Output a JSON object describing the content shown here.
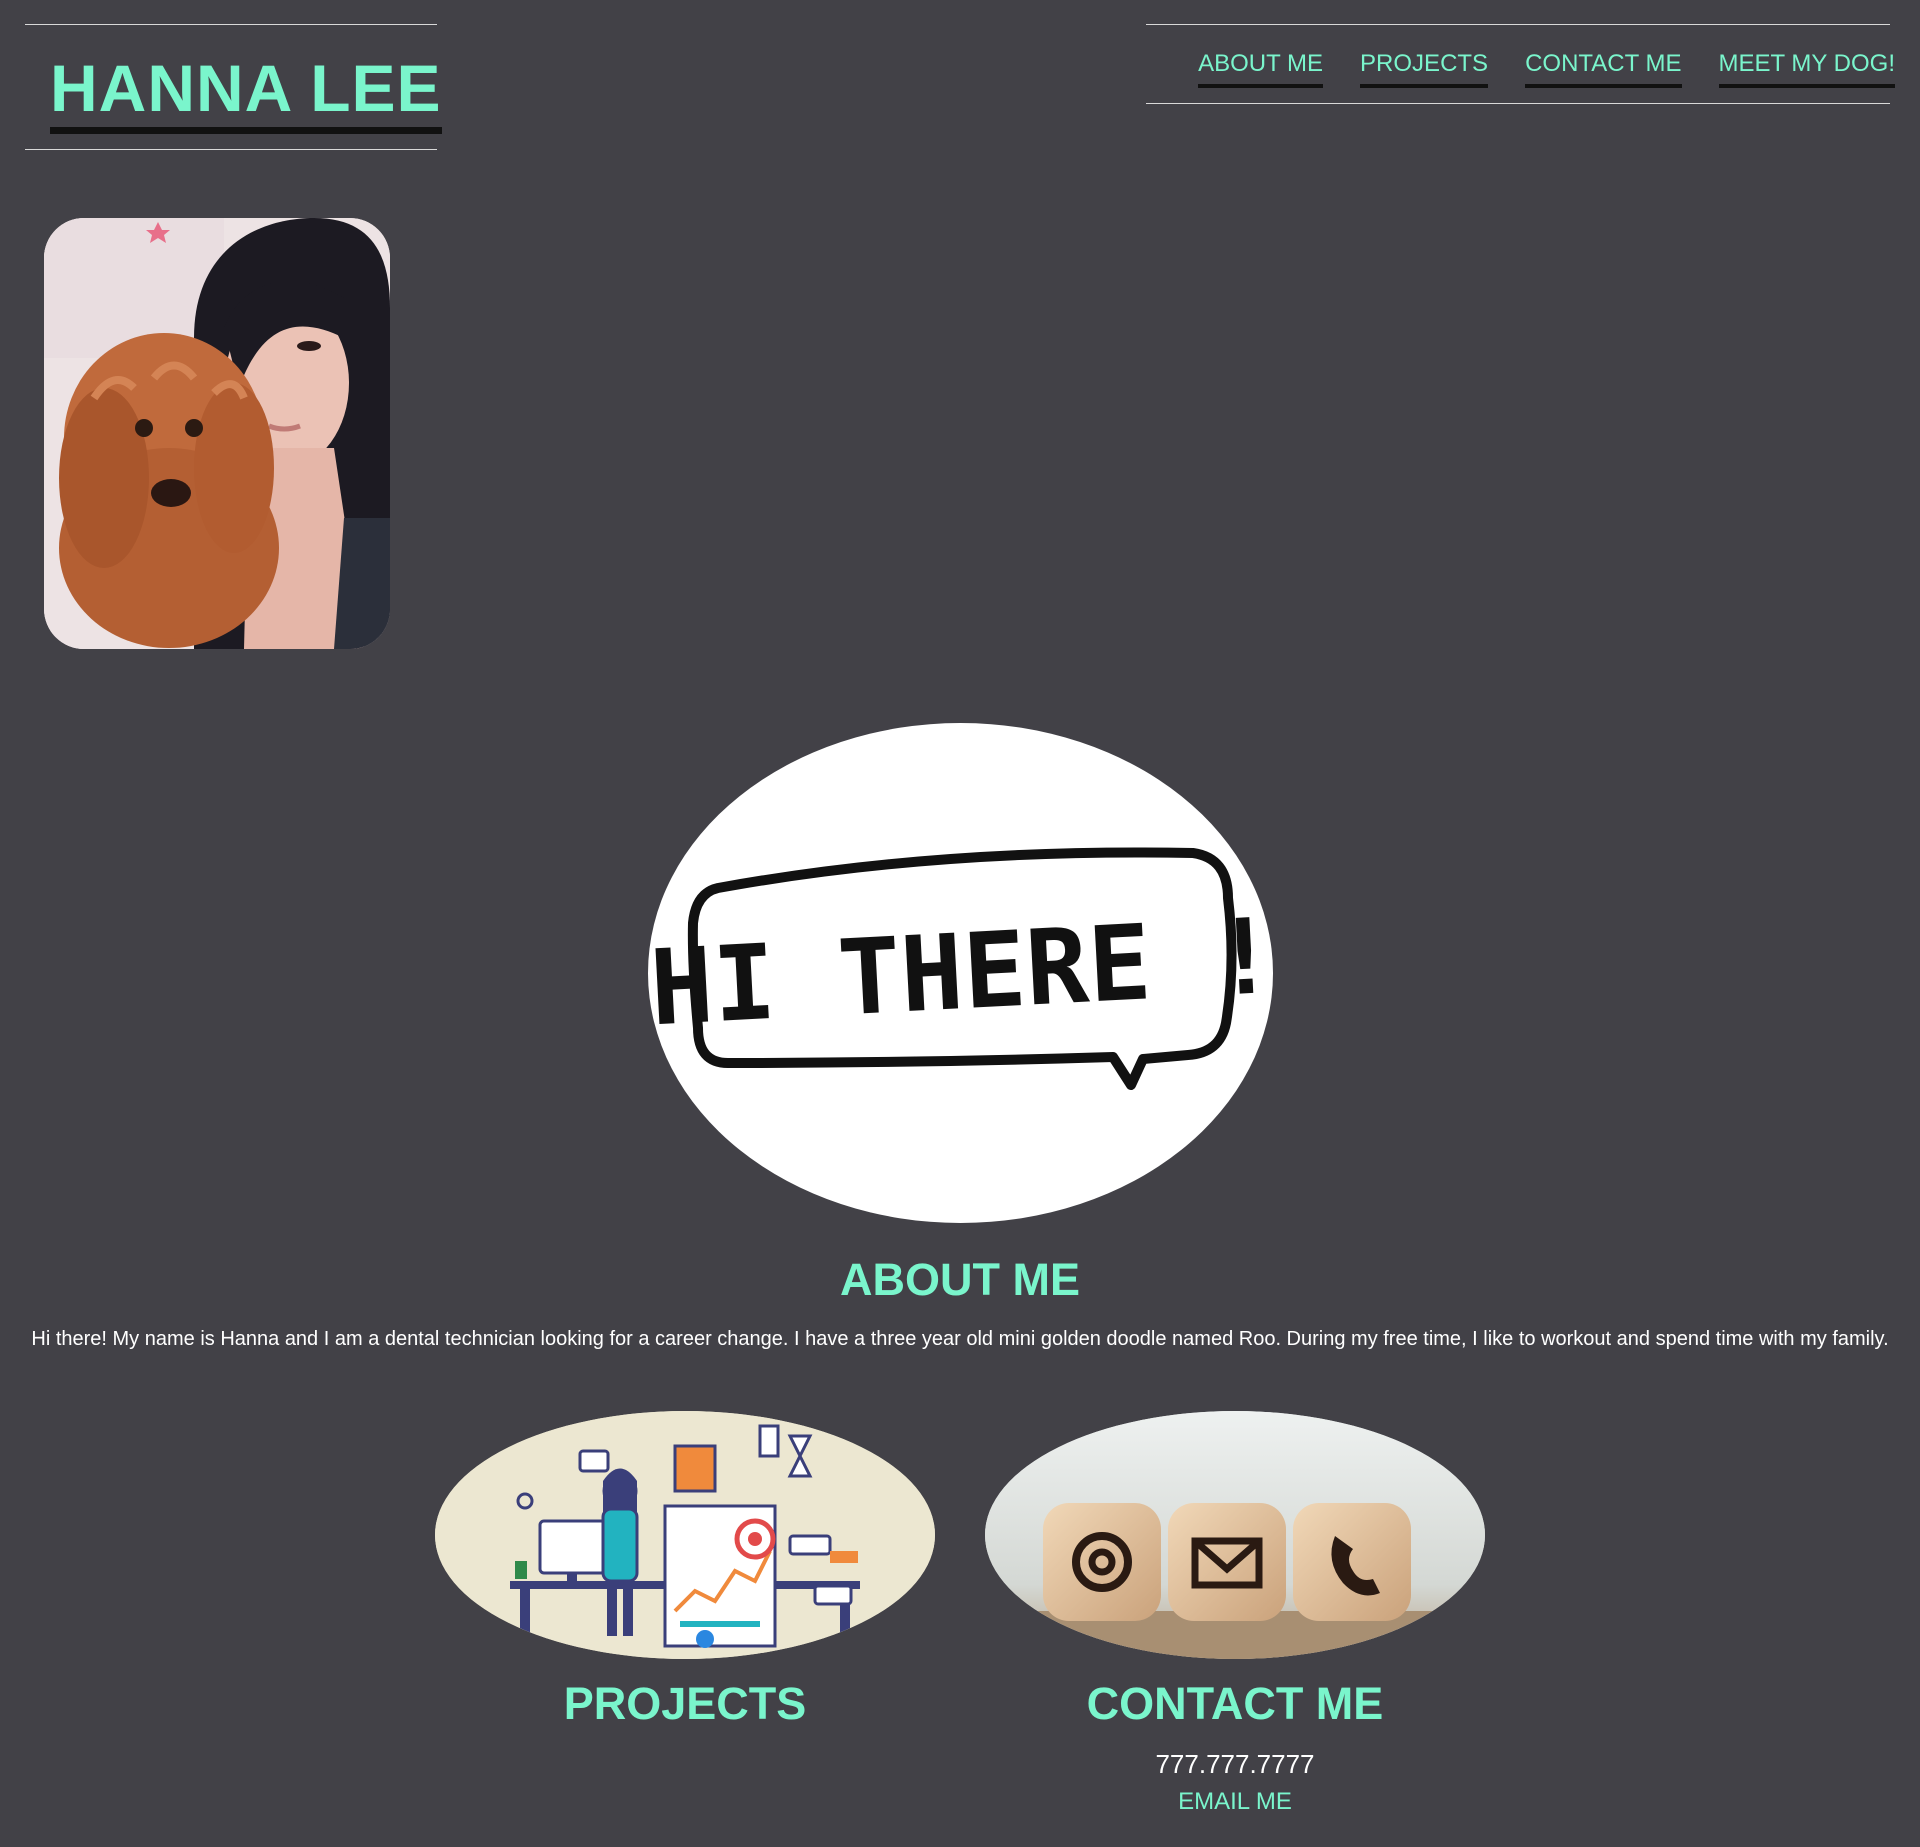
{
  "header": {
    "brand": "HANNA LEE",
    "nav": [
      {
        "label": "ABOUT ME"
      },
      {
        "label": "PROJECTS"
      },
      {
        "label": "CONTACT ME"
      },
      {
        "label": "MEET MY DOG!"
      }
    ]
  },
  "hero": {
    "bubble_text": "HI THERE !"
  },
  "about": {
    "heading": "ABOUT ME",
    "text": "Hi there! My name is Hanna and I am a dental technician looking for a career change. I have a three year old mini golden doodle named Roo. During my free time, I like to workout and spend time with my family."
  },
  "projects": {
    "heading": "PROJECTS"
  },
  "contact": {
    "heading": "CONTACT ME",
    "phone": "777.777.7777",
    "email_label": "EMAIL ME"
  },
  "colors": {
    "background": "#424147",
    "accent": "#7af5cc",
    "text": "#ffffff"
  },
  "icons": [
    "at-sign-icon",
    "envelope-icon",
    "phone-icon"
  ]
}
